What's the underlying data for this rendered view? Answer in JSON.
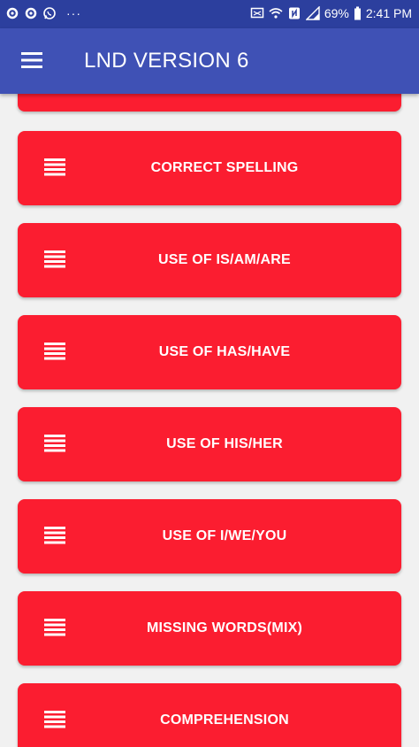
{
  "status_bar": {
    "left_icons": [
      "settings-icon",
      "settings-icon",
      "whatsapp-icon"
    ],
    "more_indicator": "···",
    "right_icons": [
      "cast-icon",
      "wifi-icon",
      "nfc-icon",
      "signal-icon",
      "battery-icon"
    ],
    "battery": "69%",
    "time": "2:41 PM"
  },
  "app_bar": {
    "title": "LND VERSION 6",
    "menu_icon": "hamburger-icon",
    "color": "#3f51b5"
  },
  "list": {
    "accent_color": "#fb1d30",
    "item_icon": "list-lines-icon",
    "items": [
      {
        "label": "CORRECT SPELLING"
      },
      {
        "label": "USE OF IS/AM/ARE"
      },
      {
        "label": "USE OF HAS/HAVE"
      },
      {
        "label": "USE OF HIS/HER"
      },
      {
        "label": "USE OF I/WE/YOU"
      },
      {
        "label": "MISSING WORDS(MIX)"
      },
      {
        "label": "COMPREHENSION"
      }
    ]
  }
}
